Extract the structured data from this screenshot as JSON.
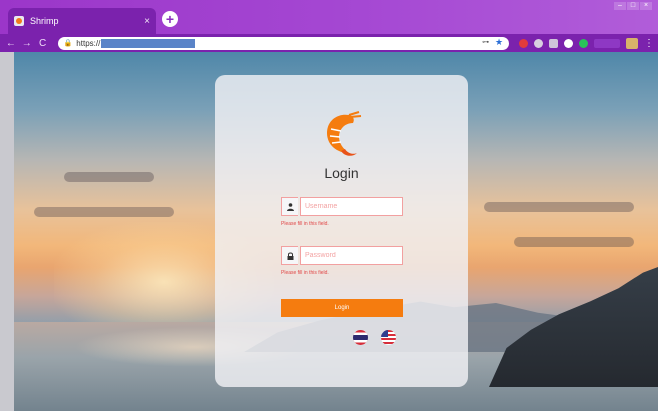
{
  "browser": {
    "tab_title": "Shrimp",
    "tab_close": "×",
    "new_tab": "+",
    "url_text": "https://",
    "window_controls": [
      "–",
      "□",
      "×"
    ],
    "nav": {
      "back": "←",
      "forward": "→",
      "reload": "C"
    },
    "lock_glyph": "🔒",
    "key_glyph": "⊶",
    "star_glyph": "★",
    "menu_glyph": "⋮"
  },
  "login": {
    "title": "Login",
    "username_placeholder": "Username",
    "password_placeholder": "Password",
    "username_error": "Please fill in this field.",
    "password_error": "Please fill in this field.",
    "button_label": "Login",
    "languages": [
      "thai-flag-icon",
      "us-flag-icon"
    ]
  },
  "colors": {
    "browser_purple": "#9b36c9",
    "toolbar_purple": "#7b22ad",
    "accent_orange": "#f57c0f",
    "error_red": "#e04848"
  },
  "icons": {
    "user": "user-icon",
    "lock": "lock-icon",
    "logo": "shrimp-logo-icon"
  }
}
